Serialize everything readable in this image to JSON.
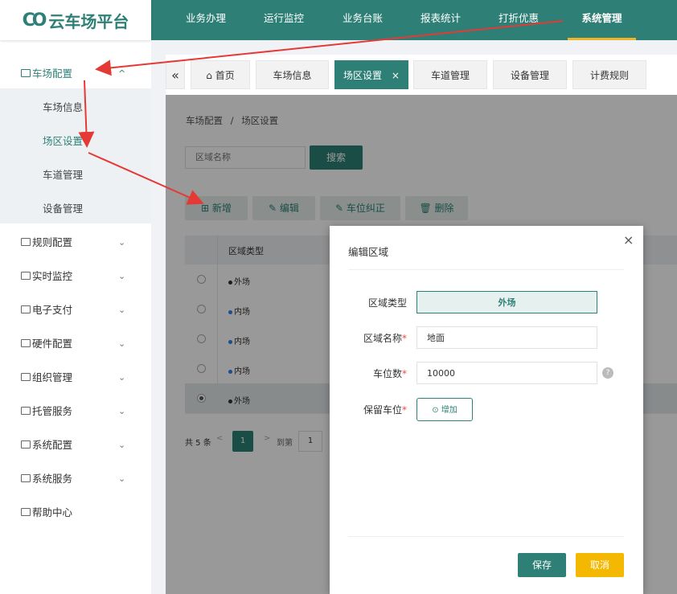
{
  "app": {
    "logo_mark": "CO",
    "name": "云车场平台"
  },
  "topnav": [
    {
      "label": "业务办理"
    },
    {
      "label": "运行监控"
    },
    {
      "label": "业务台账"
    },
    {
      "label": "报表统计"
    },
    {
      "label": "打折优惠"
    },
    {
      "label": "系统管理",
      "active": true
    }
  ],
  "sidebar": {
    "open_group": {
      "label": "车场配置",
      "chevron": "^"
    },
    "sub_items": [
      {
        "label": "车场信息"
      },
      {
        "label": "场区设置",
        "active": true
      },
      {
        "label": "车道管理"
      },
      {
        "label": "设备管理"
      }
    ],
    "groups": [
      {
        "label": "规则配置"
      },
      {
        "label": "实时监控"
      },
      {
        "label": "电子支付"
      },
      {
        "label": "硬件配置"
      },
      {
        "label": "组织管理"
      },
      {
        "label": "托管服务"
      },
      {
        "label": "系统配置"
      },
      {
        "label": "系统服务"
      },
      {
        "label": "帮助中心"
      }
    ],
    "chevron_glyph": "⌄"
  },
  "tabs": {
    "collapse_glyph": "«",
    "items": [
      {
        "label": "首页",
        "icon": "home-icon"
      },
      {
        "label": "车场信息"
      },
      {
        "label": "场区设置",
        "active": true,
        "close": "×"
      },
      {
        "label": "车道管理"
      },
      {
        "label": "设备管理"
      },
      {
        "label": "计费规则"
      }
    ]
  },
  "breadcrumb": {
    "parent": "车场配置",
    "sep": "/",
    "current": "场区设置"
  },
  "search": {
    "placeholder": "区域名称",
    "button": "搜索"
  },
  "toolbar": {
    "add": "新增",
    "edit": "编辑",
    "fix": "车位纠正",
    "delete": "删除"
  },
  "table": {
    "header": "区域类型",
    "rows": [
      {
        "type": "外场",
        "dot": "#333333",
        "selected": false
      },
      {
        "type": "内场",
        "dot": "#2f80ed",
        "selected": false
      },
      {
        "type": "内场",
        "dot": "#2f80ed",
        "selected": false
      },
      {
        "type": "内场",
        "dot": "#2f80ed",
        "selected": false
      },
      {
        "type": "外场",
        "dot": "#333333",
        "selected": true
      }
    ]
  },
  "pagination": {
    "total": "共 5 条",
    "prev": "<",
    "page": "1",
    "next": ">",
    "goto": "到第",
    "goto_value": "1"
  },
  "dialog": {
    "title": "编辑区域",
    "close": "×",
    "fields": {
      "type": {
        "label": "区域类型",
        "value": "外场"
      },
      "name": {
        "label": "区域名称",
        "req": "*",
        "value": "地面"
      },
      "count": {
        "label": "车位数",
        "req": "*",
        "value": "10000",
        "help": "?"
      },
      "reserved": {
        "label": "保留车位",
        "req": "*",
        "button": "增加",
        "icon": "⊙"
      }
    },
    "save": "保存",
    "cancel": "取消"
  },
  "colors": {
    "primary": "#2e8077",
    "accent": "#f0b429",
    "arrow": "#e53935",
    "cancel": "#f5b800"
  }
}
